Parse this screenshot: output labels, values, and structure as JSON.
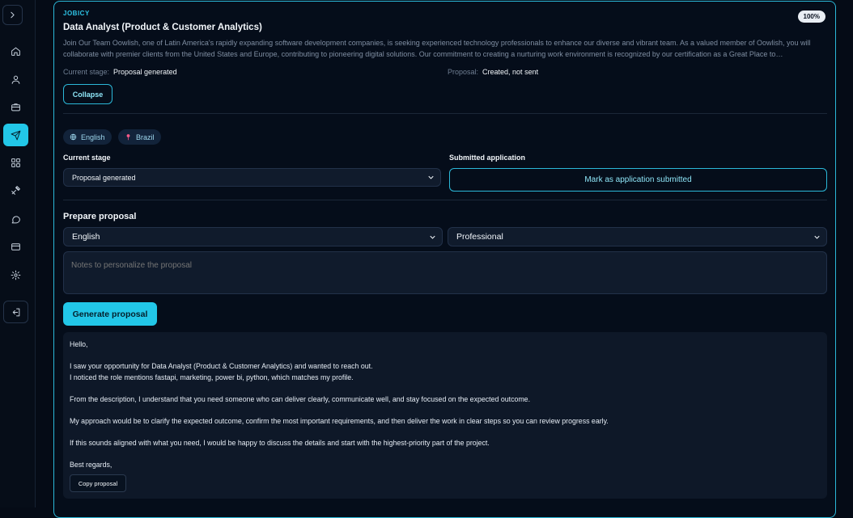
{
  "sidebar": {
    "items": [
      {
        "name": "home-icon",
        "active": false
      },
      {
        "name": "user-icon",
        "active": false
      },
      {
        "name": "briefcase-icon",
        "active": false
      },
      {
        "name": "send-icon",
        "active": true
      },
      {
        "name": "grid-icon",
        "active": false
      },
      {
        "name": "tools-icon",
        "active": false
      },
      {
        "name": "chat-icon",
        "active": false
      },
      {
        "name": "card-icon",
        "active": false
      },
      {
        "name": "gear-icon",
        "active": false
      }
    ]
  },
  "job": {
    "brand": "JOBICY",
    "progress": "100%",
    "title": "Data Analyst (Product & Customer Analytics)",
    "description": "Join Our Team Oowlish, one of Latin America's rapidly expanding software development companies, is seeking experienced technology professionals to enhance our diverse and vibrant team. As a valued member of Oowlish, you will collaborate with premier clients from the United States and Europe, contributing to pioneering digital solutions. Our commitment to creating a nurturing work environment is recognized by our certification as a Great Place to…",
    "current_stage_label": "Current stage:",
    "current_stage_value": "Proposal generated",
    "proposal_label": "Proposal:",
    "proposal_value": "Created, not sent",
    "collapse_label": "Collapse"
  },
  "tags": {
    "language": "English",
    "location": "Brazil"
  },
  "stage": {
    "label": "Current stage",
    "selected": "Proposal generated",
    "submitted_label": "Submitted application",
    "submit_button": "Mark as application submitted"
  },
  "proposal": {
    "heading": "Prepare proposal",
    "language_selected": "English",
    "tone_selected": "Professional",
    "notes_placeholder": "Notes to personalize the proposal",
    "generate_button": "Generate proposal",
    "output": {
      "greeting": "Hello,",
      "line1": "I saw your opportunity for Data Analyst (Product & Customer Analytics) and wanted to reach out.",
      "line2": "I noticed the role mentions fastapi, marketing, power bi, python, which matches my profile.",
      "para2": "From the description, I understand that you need someone who can deliver clearly, communicate well, and stay focused on the expected outcome.",
      "para3": "My approach would be to clarify the expected outcome, confirm the most important requirements, and then deliver the work in clear steps so you can review progress early.",
      "para4": "If this sounds aligned with what you need, I would be happy to discuss the details and start with the highest-priority part of the project.",
      "closing": "Best regards,"
    },
    "copy_button": "Copy proposal"
  },
  "colors": {
    "accent": "#22c7e8",
    "background": "#050b16",
    "panel": "#101b2c"
  }
}
